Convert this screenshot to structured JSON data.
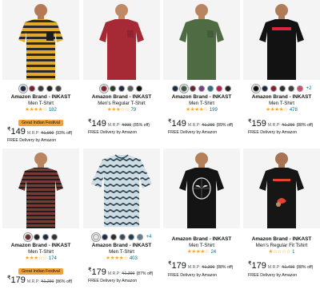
{
  "products": [
    {
      "brand": "Amazon Brand - INKAST",
      "title": "Men T-Shirt",
      "stars": "★★★★☆",
      "review_count": "182",
      "badge": "Great Indian Festival",
      "currency": "₹",
      "price": "149",
      "mrp_label": "M.R.P:",
      "mrp": "₹1,999",
      "discount": "(93% off)",
      "delivery": "FREE Delivery by Amazon",
      "more_colors": "",
      "swatches": [
        "#1b2a44",
        "#7a1f2b",
        "#3b3b3b",
        "#222222",
        "#444444"
      ],
      "shirt_color": "#e3ab2d",
      "stripe_color": "#2a2a2a",
      "image": "yellow-striped-pocket-tee"
    },
    {
      "brand": "Amazon Brand - INKAST",
      "title": "Men's Regular T-Shirt",
      "stars": "★★★☆☆",
      "review_count": "79",
      "badge": "",
      "currency": "₹",
      "price": "149",
      "mrp_label": "M.R.P:",
      "mrp": "₹999",
      "discount": "(85% off)",
      "delivery": "FREE Delivery by Amazon",
      "more_colors": "",
      "swatches": [
        "#8a1e28",
        "#2a3d2a",
        "#1f2a44",
        "#5a5a5a",
        "#111111"
      ],
      "shirt_color": "#a52a36",
      "stripe_color": "",
      "image": "maroon-pocket-tee"
    },
    {
      "brand": "Amazon Brand - INKAST",
      "title": "Men T-Shirt",
      "stars": "★★★★☆",
      "review_count": "199",
      "badge": "",
      "currency": "₹",
      "price": "149",
      "mrp_label": "M.R.P:",
      "mrp": "₹1,299",
      "discount": "(89% off)",
      "delivery": "FREE Delivery by Amazon",
      "more_colors": "",
      "swatches": [
        "#1d2b4a",
        "#3e5a3c",
        "#6a2232",
        "#7a3c8c",
        "#2b6e8c",
        "#c2185b",
        "#222222"
      ],
      "shirt_color": "#4f6b43",
      "stripe_color": "",
      "image": "olive-pocket-tee"
    },
    {
      "brand": "Amazon Brand - INKAST",
      "title": "Men T-Shirt",
      "stars": "★★★★☆",
      "review_count": "478",
      "badge": "",
      "currency": "₹",
      "price": "159",
      "mrp_label": "M.R.P:",
      "mrp": "₹1,299",
      "discount": "(88% off)",
      "delivery": "FREE Delivery by Amazon",
      "more_colors": "+2",
      "swatches": [
        "#111111",
        "#1b2a44",
        "#8a1e28",
        "#2e2e2e",
        "#3b3b3b",
        "#d84a6a"
      ],
      "shirt_color": "#121212",
      "stripe_color": "#d7263d",
      "image": "black-graphic-tee"
    },
    {
      "brand": "Amazon Brand - INKAST",
      "title": "Men T-Shirt",
      "stars": "★★★☆☆",
      "review_count": "174",
      "badge": "Great Indian Festival",
      "currency": "₹",
      "price": "179",
      "mrp_label": "M.R.P:",
      "mrp": "₹1,299",
      "discount": "(86% off)",
      "delivery": "FREE Delivery by Amazon",
      "more_colors": "",
      "swatches": [
        "#6b2b2b",
        "#222222",
        "#1b2a44",
        "#333333"
      ],
      "shirt_color": "#7a3a33",
      "stripe_color": "#1e1e1e",
      "image": "brown-striped-tee"
    },
    {
      "brand": "Amazon Brand - INKAST",
      "title": "Men T-Shirt",
      "stars": "★★★★☆",
      "review_count": "403",
      "badge": "",
      "currency": "₹",
      "price": "179",
      "mrp_label": "M.R.P:",
      "mrp": "₹1,399",
      "discount": "(87% off)",
      "delivery": "FREE Delivery by Amazon",
      "more_colors": "+4",
      "swatches": [
        "#dfe7ec",
        "#1d2b4a",
        "#2c2c2c",
        "#3c4a5c",
        "#1e3f52",
        "#5e7f92"
      ],
      "shirt_color": "#cfdde3",
      "stripe_color": "#2c4658",
      "image": "tie-dye-striped-tee"
    },
    {
      "brand": "Amazon Brand - INKAST",
      "title": "Men T-Shirt",
      "stars": "★★★★☆",
      "review_count": "24",
      "badge": "",
      "currency": "₹",
      "price": "179",
      "mrp_label": "M.R.P:",
      "mrp": "₹1,399",
      "discount": "(88% off)",
      "delivery": "FREE Delivery by Amazon",
      "more_colors": "",
      "swatches": [],
      "shirt_color": "#141414",
      "stripe_color": "#e6e6e6",
      "image": "spider-man-graphic-tee"
    },
    {
      "brand": "Amazon Brand - INKAST",
      "title": "Men's Regular Fit Tshirt",
      "stars": "★☆☆☆☆",
      "review_count": "1",
      "badge": "",
      "currency": "₹",
      "price": "179",
      "mrp_label": "M.R.P:",
      "mrp": "₹1,499",
      "discount": "(88% off)",
      "delivery": "FREE Delivery by Amazon",
      "more_colors": "",
      "swatches": [],
      "shirt_color": "#161616",
      "stripe_color": "#e0452f",
      "image": "spider-man-logo-tee"
    }
  ]
}
